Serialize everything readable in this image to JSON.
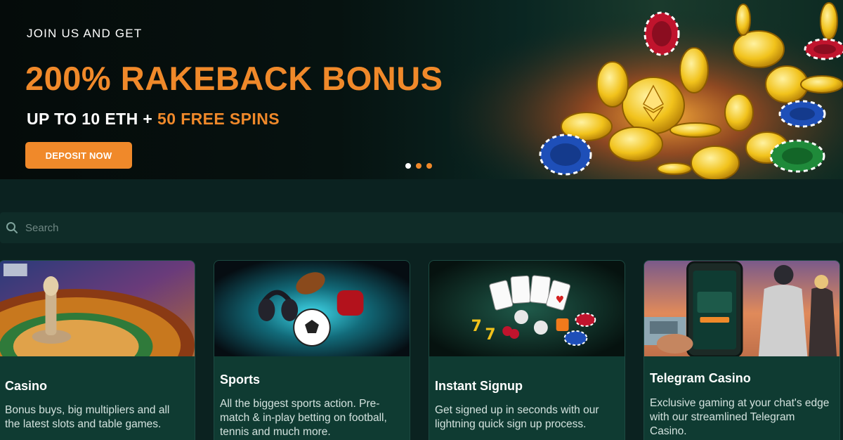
{
  "hero": {
    "kicker": "JOIN US AND GET",
    "title": "200% RAKEBACK BONUS",
    "subtitle_main": "UP TO 10 ETH + ",
    "subtitle_accent": "50 FREE SPINS",
    "cta_label": "DEPOSIT NOW",
    "carousel": {
      "count": 3,
      "active_index": 0
    }
  },
  "search": {
    "placeholder": "Search",
    "value": ""
  },
  "cards": [
    {
      "title": "Casino",
      "description": "Bonus buys, big multipliers and all the latest slots and table games."
    },
    {
      "title": "Sports",
      "description": "All the biggest sports action. Pre-match & in-play betting on football, tennis and much more."
    },
    {
      "title": "Instant Signup",
      "description": "Get signed up in seconds with our lightning quick sign up process."
    },
    {
      "title": "Telegram Casino",
      "description": "Exclusive gaming at your chat's edge with our streamlined Telegram Casino."
    }
  ],
  "colors": {
    "accent": "#f0892a",
    "background": "#0b2220",
    "card": "#0f3b32"
  }
}
